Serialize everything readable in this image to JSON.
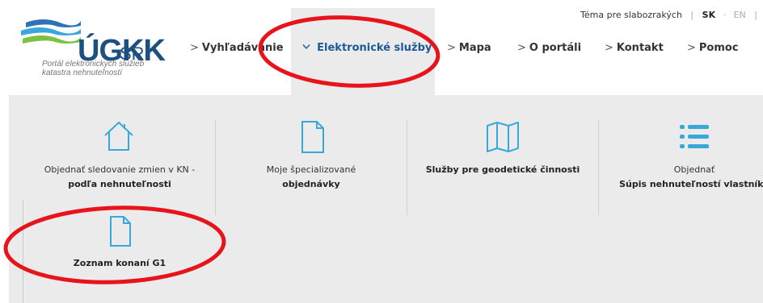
{
  "logo": {
    "name": "ÚGKK",
    "suffix": "SR",
    "tagline_line1": "Portál elektronických služieb",
    "tagline_line2": "katastra nehnuteľností"
  },
  "utility": {
    "high_contrast": "Téma pre slabozrakých",
    "lang_sk": "SK",
    "lang_en": "EN"
  },
  "nav": [
    {
      "label": "Vyhľadávanie"
    },
    {
      "label": "Elektronické služby"
    },
    {
      "label": "Mapa"
    },
    {
      "label": "O portáli"
    },
    {
      "label": "Kontakt"
    },
    {
      "label": "Pomoc"
    }
  ],
  "submenu": [
    {
      "icon": "home-icon",
      "line1": "Objednať sledovanie zmien v KN -",
      "line2": "podľa nehnuteľnosti"
    },
    {
      "icon": "document-icon",
      "line1": "Moje špecializované",
      "line2": "objednávky"
    },
    {
      "icon": "map-icon",
      "line1": "Služby pre geodetické činnosti",
      "line2": ""
    },
    {
      "icon": "list-icon",
      "line1": "Objednať",
      "line2": "Súpis nehnuteľností vlastníka"
    },
    {
      "icon": "document-icon",
      "line1": "Zoznam konaní G1",
      "line2": ""
    }
  ],
  "colors": {
    "brand_blue": "#1c4f82",
    "link_blue": "#1c5a96",
    "icon_blue": "#3aa7dc",
    "panel_gray": "#ebebeb",
    "annotation_red": "#e8141b"
  }
}
